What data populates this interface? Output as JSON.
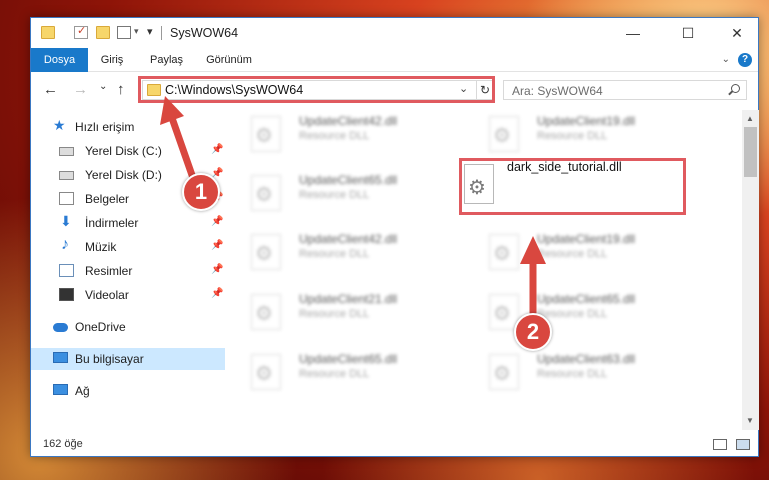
{
  "window": {
    "title": "SysWOW64",
    "controls": {
      "minimize": "—",
      "maximize": "☐",
      "close": "✕"
    }
  },
  "ribbon": {
    "tabs": [
      "Dosya",
      "Giriş",
      "Paylaş",
      "Görünüm"
    ],
    "active_tab": "Dosya",
    "help": "?"
  },
  "navigation": {
    "back": "←",
    "forward": "→",
    "recent": "⌄",
    "up": "↑",
    "address": "C:\\Windows\\SysWOW64",
    "address_dropdown": "⌄",
    "refresh": "↻",
    "search_placeholder": "Ara: SysWOW64"
  },
  "sidebar": {
    "items": [
      {
        "label": "Hızlı erişim",
        "icon": "quick-access-icon",
        "pinned": false,
        "selected": false
      },
      {
        "label": "Yerel Disk (C:)",
        "icon": "drive-icon",
        "pinned": true,
        "selected": false
      },
      {
        "label": "Yerel Disk (D:)",
        "icon": "drive-icon",
        "pinned": true,
        "selected": false
      },
      {
        "label": "Belgeler",
        "icon": "documents-icon",
        "pinned": true,
        "selected": false
      },
      {
        "label": "İndirmeler",
        "icon": "downloads-icon",
        "pinned": true,
        "selected": false
      },
      {
        "label": "Müzik",
        "icon": "music-icon",
        "pinned": true,
        "selected": false
      },
      {
        "label": "Resimler",
        "icon": "pictures-icon",
        "pinned": true,
        "selected": false
      },
      {
        "label": "Videolar",
        "icon": "videos-icon",
        "pinned": true,
        "selected": false
      },
      {
        "label": "OneDrive",
        "icon": "onedrive-icon",
        "pinned": false,
        "selected": false
      },
      {
        "label": "Bu bilgisayar",
        "icon": "computer-icon",
        "pinned": false,
        "selected": true
      },
      {
        "label": "Ağ",
        "icon": "network-icon",
        "pinned": false,
        "selected": false
      }
    ],
    "pin_glyph": "📌"
  },
  "files": [
    {
      "name": "UpdateClient42.dll",
      "type": "Resource DLL"
    },
    {
      "name": "UpdateClient19.dll",
      "type": "Resource DLL"
    },
    {
      "name": "UpdateClient65.dll",
      "type": "Resource DLL"
    },
    {
      "name": "dark_side_tutorial.dll",
      "type": ""
    },
    {
      "name": "UpdateClient42.dll",
      "type": "Resource DLL"
    },
    {
      "name": "UpdateClient19.dll",
      "type": "Resource DLL"
    },
    {
      "name": "UpdateClient21.dll",
      "type": "Resource DLL"
    },
    {
      "name": "UpdateClient65.dll",
      "type": "Resource DLL"
    },
    {
      "name": "UpdateClient65.dll",
      "type": "Resource DLL"
    },
    {
      "name": "UpdateClient63.dll",
      "type": "Resource DLL"
    }
  ],
  "status": {
    "item_count": "162 öğe"
  },
  "annotations": {
    "step1": "1",
    "step2": "2",
    "color": "#d9473f"
  }
}
